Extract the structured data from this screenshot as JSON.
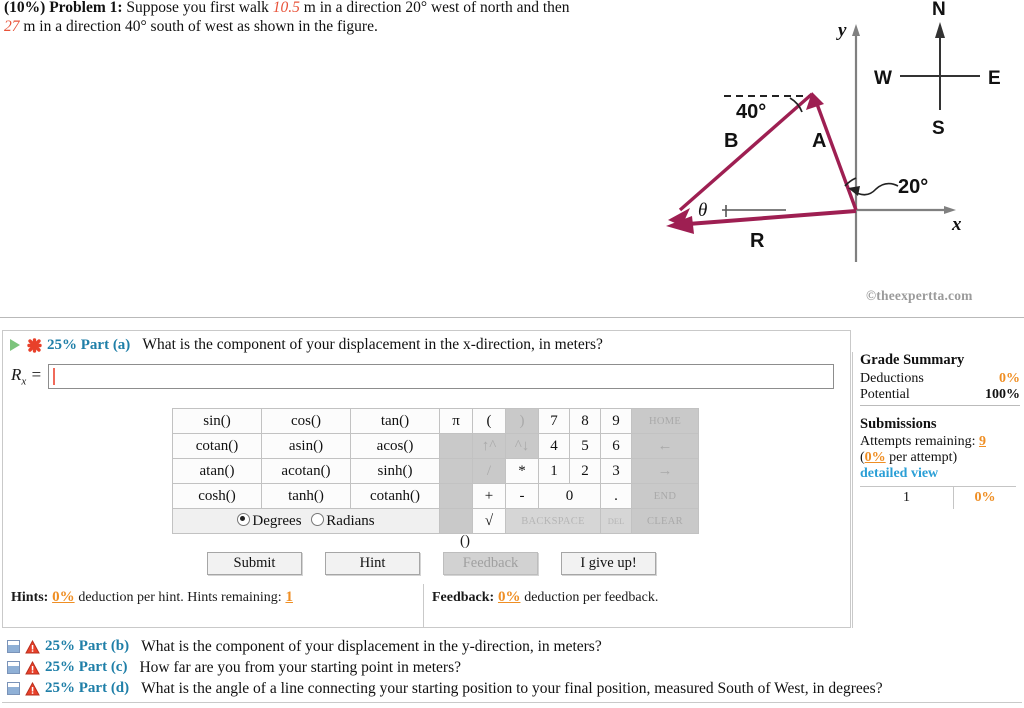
{
  "problem": {
    "weight": "(10%)",
    "label": "Problem 1:",
    "text_part1": "Suppose you first walk",
    "value1": "10.5",
    "text_part2": "m in a direction 20° west of north and then",
    "value2": "27",
    "text_part3": "m in a direction 40° south of west as shown in the figure."
  },
  "figure": {
    "vector_a_label": "A",
    "vector_b_label": "B",
    "vector_r_label": "R",
    "angle_40": "40°",
    "angle_20": "20°",
    "theta_label": "θ",
    "axis_x": "x",
    "axis_y": "y",
    "compass_n": "N",
    "compass_s": "S",
    "compass_e": "E",
    "compass_w": "W",
    "watermark": "©theexpertta.com",
    "vector_color": "#9e1f52"
  },
  "part_a": {
    "percent": "25% Part (a)",
    "question": "What is the component of your displacement in the x-direction, in meters?",
    "answer_label": "R",
    "answer_sub": "x",
    "equals": "=",
    "input_value": "",
    "input_placeholder": ""
  },
  "keypad": {
    "rows": [
      [
        "sin()",
        "cos()",
        "tan()",
        "π",
        "(",
        ")",
        "7",
        "8",
        "9",
        "HOME"
      ],
      [
        "cotan()",
        "asin()",
        "acos()",
        "",
        "↑^",
        "^↓",
        "4",
        "5",
        "6",
        "←"
      ],
      [
        "atan()",
        "acotan()",
        "sinh()",
        "",
        "/",
        "*",
        "1",
        "2",
        "3",
        "→"
      ],
      [
        "cosh()",
        "tanh()",
        "cotanh()",
        "",
        "+",
        "-",
        "0",
        ".",
        "END"
      ],
      [
        "",
        "√",
        "BACKSPACE",
        "DEL",
        "CLEAR"
      ]
    ],
    "degrees_label": "Degrees",
    "radians_label": "Radians",
    "angle_mode": "Degrees",
    "paren_button": "()"
  },
  "buttons": {
    "submit": "Submit",
    "hint": "Hint",
    "feedback": "Feedback",
    "give_up": "I give up!"
  },
  "hints": {
    "title": "Hints:",
    "deduction": "0%",
    "text": "deduction per hint. Hints remaining:",
    "remaining": "1"
  },
  "feedback": {
    "title": "Feedback:",
    "deduction": "0%",
    "text": "deduction per feedback."
  },
  "grade_summary": {
    "title": "Grade Summary",
    "deductions_label": "Deductions",
    "deductions_value": "0%",
    "potential_label": "Potential",
    "potential_value": "100%",
    "submissions_title": "Submissions",
    "attempts_label": "Attempts remaining:",
    "attempts_value": "9",
    "per_attempt_pct": "0%",
    "per_attempt_text": "per attempt)",
    "per_attempt_open": "(",
    "detailed_view": "detailed view",
    "attempt_rows": [
      {
        "num": "1",
        "score": "0%"
      }
    ]
  },
  "other_parts": [
    {
      "percent": "25% Part (b)",
      "question": "What is the component of your displacement in the y-direction, in meters?"
    },
    {
      "percent": "25% Part (c)",
      "question": "How far are you from your starting point in meters?"
    },
    {
      "percent": "25% Part (d)",
      "question": "What is the angle of a line connecting your starting position to your final position, measured South of West, in degrees?"
    }
  ]
}
